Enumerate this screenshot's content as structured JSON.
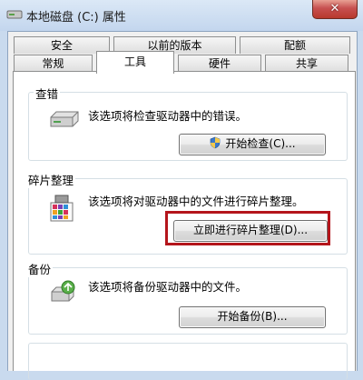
{
  "window": {
    "title": "本地磁盘 (C:) 属性",
    "close_label": "✕"
  },
  "tabs": {
    "row1": [
      "安全",
      "以前的版本",
      "配额"
    ],
    "row2": [
      "常规",
      "工具",
      "硬件",
      "共享"
    ],
    "active": "工具"
  },
  "sections": {
    "check": {
      "label": "查错",
      "description": "该选项将检查驱动器中的错误。",
      "button": "开始检查(C)...",
      "icon": "drive-icon"
    },
    "defrag": {
      "label": "碎片整理",
      "description": "该选项将对驱动器中的文件进行碎片整理。",
      "button": "立即进行碎片整理(D)...",
      "icon": "defrag-icon"
    },
    "backup": {
      "label": "备份",
      "description": "该选项将备份驱动器中的文件。",
      "button": "开始备份(B)...",
      "icon": "backup-icon"
    }
  },
  "colors": {
    "highlight": "#b4151b",
    "title_bg": "#c9daee",
    "close": "#c75050"
  }
}
